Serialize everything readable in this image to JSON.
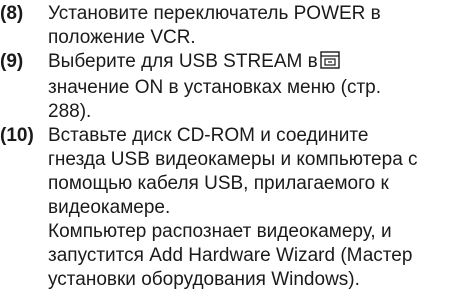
{
  "steps": [
    {
      "number": "(8)",
      "lines": [
        "Установите переключатель POWER в",
        "положение VCR."
      ]
    },
    {
      "number": "(9)",
      "line1_before_icon": "Выберите для USB STREAM в",
      "icon": "menu-settings-icon",
      "lines_after": [
        "значение ON в установках меню (стр.",
        "288)."
      ]
    },
    {
      "number": "(10)",
      "lines": [
        "Вставьте диск CD-ROM и соедините",
        "гнезда USB видеокамеры и компьютера с",
        "помощью кабеля USB, прилагаемого к",
        "видеокамере.",
        "Компьютер распознает видеокамеру, и",
        "запустится Add Hardware Wizard (Мастер",
        "установки оборудования Windows)."
      ]
    }
  ]
}
